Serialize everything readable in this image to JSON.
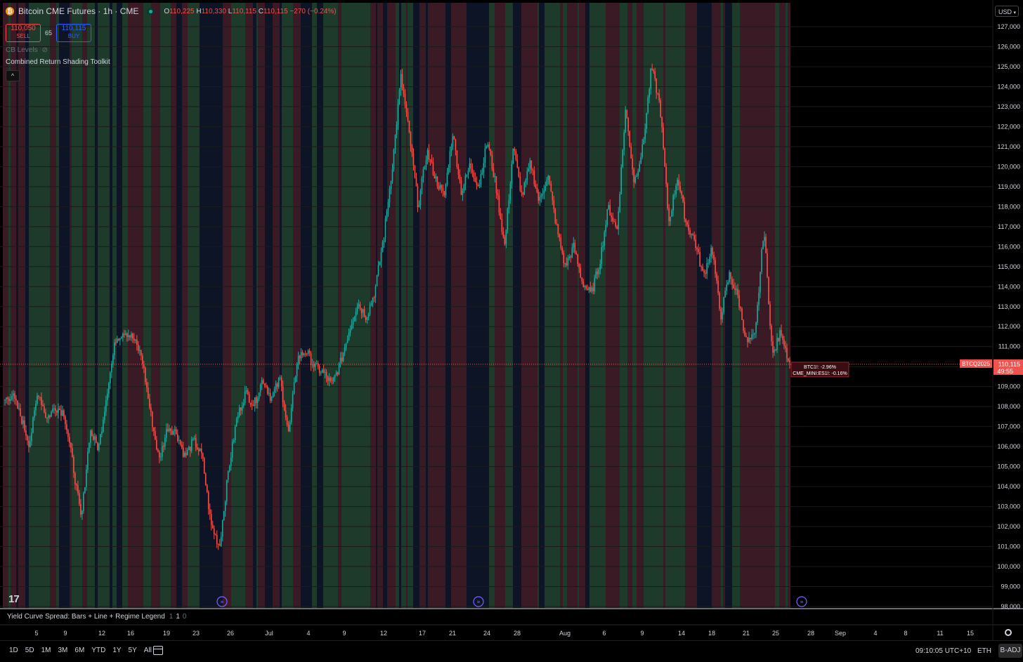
{
  "header": {
    "coin_icon_glyph": "₿",
    "symbol_title": "Bitcoin CME Futures · 1h · CME",
    "ohlc": {
      "o_label": "O",
      "o": "110,225",
      "h_label": "H",
      "h": "110,330",
      "l_label": "L",
      "l": "110,115",
      "c_label": "C",
      "c": "110,115",
      "change": "−270 (−0.24%)"
    },
    "sell_price": "110,050",
    "sell_label": "SELL",
    "spread": "65",
    "buy_price": "110,115",
    "buy_label": "BUY",
    "indicator_cb": "CB Levels",
    "indicator_toolkit": "Combined Return Shading Toolkit",
    "collapse_glyph": "^"
  },
  "currency_selector": "USD",
  "price_axis": {
    "labels": [
      "127,000",
      "126,000",
      "125,000",
      "124,000",
      "123,000",
      "122,000",
      "121,000",
      "120,000",
      "119,000",
      "118,000",
      "117,000",
      "116,000",
      "115,000",
      "114,000",
      "113,000",
      "112,000",
      "111,000",
      "110,000",
      "109,000",
      "108,000",
      "107,000",
      "106,000",
      "105,000",
      "104,000",
      "103,000",
      "102,000",
      "101,000",
      "100,000",
      "99,000",
      "98,000"
    ],
    "last_price": "110,115",
    "countdown": "49:55",
    "symbol_tag": "BTCQ2025"
  },
  "tooltip": {
    "line1": "BTC1!: -2.96%",
    "line2": "CME_MINI:ES1!: -0.16%"
  },
  "time_axis": {
    "labels": [
      "5",
      "9",
      "12",
      "16",
      "19",
      "23",
      "26",
      "Jul",
      "4",
      "9",
      "12",
      "17",
      "21",
      "24",
      "28",
      "Aug",
      "6",
      "9",
      "14",
      "18",
      "21",
      "25",
      "28",
      "Sep",
      "4",
      "8",
      "11",
      "15"
    ]
  },
  "lower_pane": {
    "title": "Yield Curve Spread: Bars + Line + Regime Legend",
    "v1": "1",
    "v2": "1",
    "v3": "0"
  },
  "bottom_bar": {
    "ranges": [
      "1D",
      "5D",
      "1M",
      "3M",
      "6M",
      "YTD",
      "1Y",
      "5Y",
      "All"
    ],
    "clock": "09:10:05 UTC+10",
    "session": "ETH",
    "adjustment": "B-ADJ"
  },
  "logo_text": "17",
  "colors": {
    "up": "#26a69a",
    "down": "#ef5350",
    "shade_green": "#1d3a2a",
    "shade_red": "#3a1a24",
    "shade_navy": "#0c1426",
    "background": "#000000",
    "events": "#7b61ff"
  },
  "chart_data": {
    "type": "candlestick",
    "y_range": [
      98000,
      127400
    ],
    "last": 110115,
    "path_keypoints": [
      [
        108300,
        108600,
        107500,
        106100,
        108800,
        107400,
        108000,
        107700,
        105200,
        102300,
        106800,
        105900,
        108800,
        111400,
        111800,
        111400,
        110500,
        107700,
        105300,
        107000,
        106700,
        105500,
        106300,
        105500,
        102100,
        101000,
        104700,
        107400,
        108700,
        108100,
        109400,
        108400,
        109400,
        106600,
        110400,
        110800,
        110000,
        109700,
        109100,
        110200,
        111800,
        113200,
        112500,
        113800,
        116500,
        120000,
        124500,
        121500,
        118000,
        120800,
        119400,
        118500,
        121700,
        118700,
        120100,
        119000,
        121300,
        119000,
        116000,
        121000,
        118500,
        120200,
        118200,
        119600,
        117000,
        115000,
        116000,
        114200,
        113600,
        115200,
        118000,
        116800,
        122900,
        119200,
        121000,
        125000,
        123000,
        117200,
        119500,
        117200,
        116300,
        114500,
        116000,
        112500,
        114600,
        113500,
        111200,
        111500,
        117000,
        110500,
        111800,
        110100
      ]
    ],
    "shading_types": [
      "green",
      "red",
      "navy"
    ],
    "event_markers": 3
  }
}
